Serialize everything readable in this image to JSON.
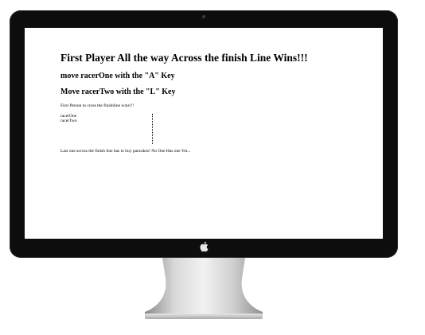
{
  "page": {
    "title": "First Player All the way Across the finish Line Wins!!!",
    "instruction_one": "move racerOne with the \"A\" Key",
    "instruction_two": "Move racerTwo with the \"L\" Key",
    "intro": "First Person to cross the finishline wins!!!",
    "racers": [
      "racerOne",
      "racerTwo"
    ],
    "footer": "Last one across the finish line has to buy pancakes! No One Has one Yet..."
  },
  "device": {
    "logo_icon": "apple-logo-icon",
    "bezel_color": "#0d0d0d",
    "stand_color": "#c8c8c8"
  }
}
